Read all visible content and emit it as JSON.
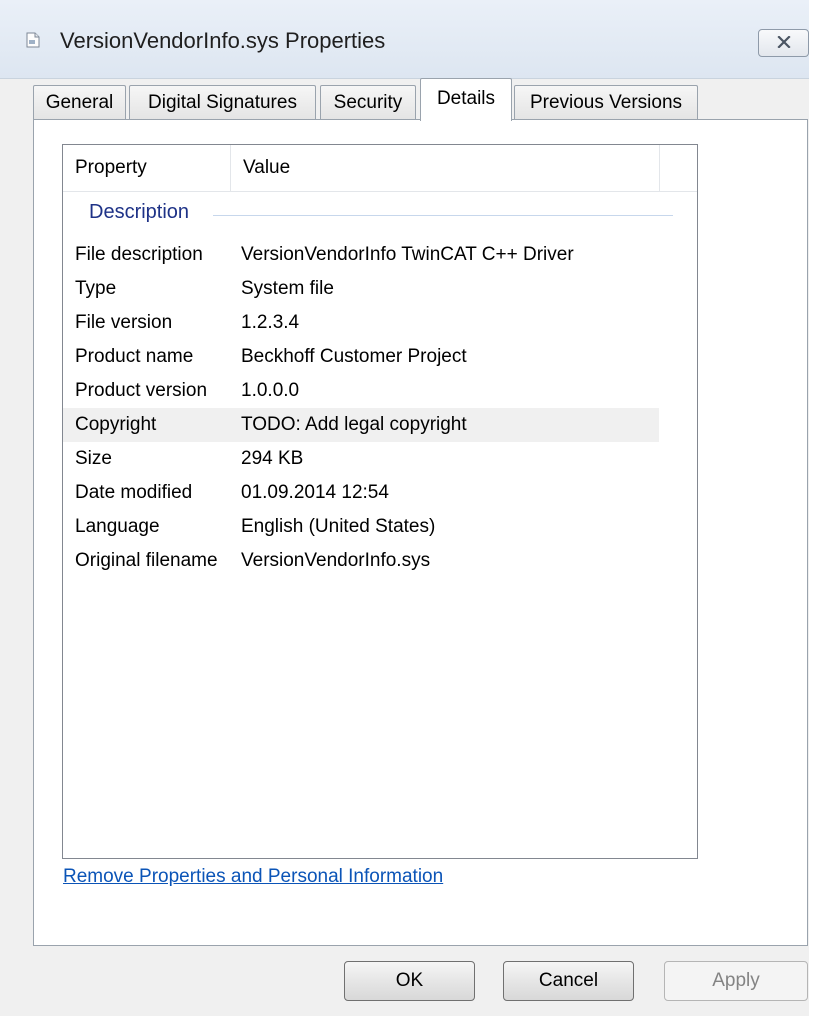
{
  "window": {
    "title": "VersionVendorInfo.sys Properties"
  },
  "tabs": [
    {
      "label": "General"
    },
    {
      "label": "Digital Signatures"
    },
    {
      "label": "Security"
    },
    {
      "label": "Details",
      "active": true
    },
    {
      "label": "Previous Versions"
    }
  ],
  "listview": {
    "columns": [
      "Property",
      "Value"
    ],
    "group": "Description",
    "rows": [
      {
        "property": "File description",
        "value": "VersionVendorInfo TwinCAT C++ Driver"
      },
      {
        "property": "Type",
        "value": "System file"
      },
      {
        "property": "File version",
        "value": "1.2.3.4"
      },
      {
        "property": "Product name",
        "value": "Beckhoff Customer Project"
      },
      {
        "property": "Product version",
        "value": "1.0.0.0"
      },
      {
        "property": "Copyright",
        "value": "TODO: Add legal copyright",
        "selected": true
      },
      {
        "property": "Size",
        "value": "294 KB"
      },
      {
        "property": "Date modified",
        "value": "01.09.2014 12:54"
      },
      {
        "property": "Language",
        "value": "English (United States)"
      },
      {
        "property": "Original filename",
        "value": "VersionVendorInfo.sys"
      }
    ]
  },
  "link": {
    "remove_properties": "Remove Properties and Personal Information"
  },
  "buttons": {
    "ok": "OK",
    "cancel": "Cancel",
    "apply": "Apply"
  },
  "colors": {
    "group_header": "#1e3287",
    "link": "#0b54b7",
    "selected_row": "#f0f0f0"
  }
}
